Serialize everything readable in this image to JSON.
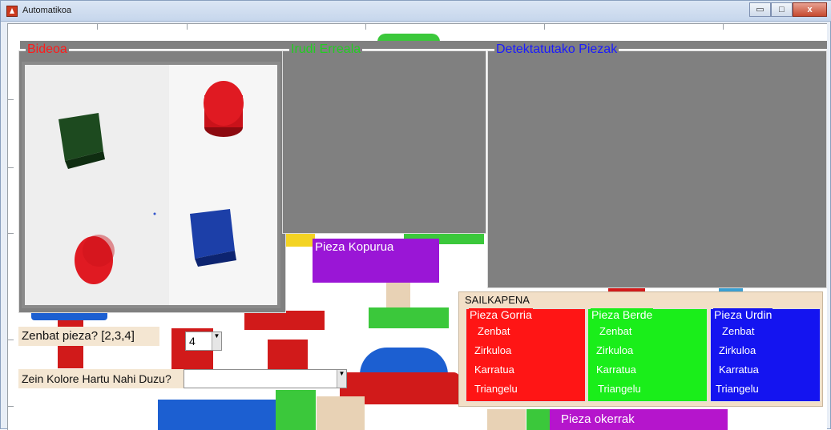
{
  "window": {
    "title": "Automatikoa"
  },
  "titlebar": {
    "minimize": "▭",
    "maximize": "□",
    "close": "x"
  },
  "panels": {
    "bideoa": {
      "title": "Bideoa",
      "color": "#ff1a1a"
    },
    "irudi_erreala": {
      "title": "Irudi Erreala",
      "color": "#22cc22"
    },
    "detektatutako": {
      "title": "Detektatutako Piezak",
      "color": "#1a1aff"
    }
  },
  "pieza_kopurua": {
    "title": "Pieza Kopurua"
  },
  "zenbat_pieza": {
    "label": "Zenbat pieza? [2,3,4]",
    "selected": "4"
  },
  "kolorea": {
    "label": "Zein Kolore Hartu Nahi Duzu?",
    "selected": ""
  },
  "sailkapena": {
    "title": "SAILKAPENA",
    "groups": [
      {
        "title": "Pieza Gorria",
        "color": "#ff1515",
        "rows": [
          "Zenbat",
          "Zirkuloa",
          "Karratua",
          "Triangelu"
        ]
      },
      {
        "title": "Pieza Berde",
        "color": "#1aee1a",
        "rows": [
          "Zenbat",
          "Zirkuloa",
          "Karratua",
          "Triangelu"
        ]
      },
      {
        "title": "Pieza Urdin",
        "color": "#1414f0",
        "rows": [
          "Zenbat",
          "Zirkuloa",
          "Karratua",
          "Triangelu"
        ]
      }
    ]
  },
  "okerrak": {
    "label": "Pieza okerrak"
  },
  "video_scene": {
    "shapes": [
      {
        "kind": "cube",
        "color": "#1d4a1f"
      },
      {
        "kind": "cylinder",
        "color": "#d0121a"
      },
      {
        "kind": "cube",
        "color": "#1c3fa8"
      },
      {
        "kind": "cylinder",
        "color": "#d0121a"
      }
    ]
  }
}
